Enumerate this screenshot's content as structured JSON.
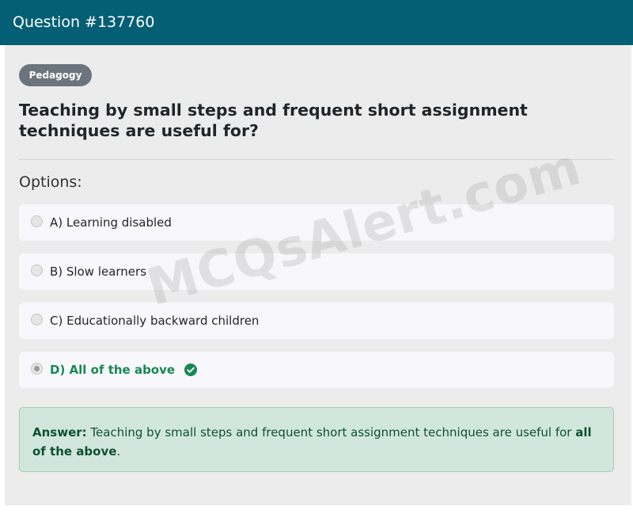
{
  "header": {
    "title": "Question #137760"
  },
  "tag": {
    "label": "Pedagogy"
  },
  "question": {
    "text": "Teaching by small steps and frequent short assignment techniques are useful for?"
  },
  "options_label": "Options:",
  "options": [
    {
      "label": "A) Learning disabled",
      "selected": false,
      "correct": false
    },
    {
      "label": "B) Slow learners",
      "selected": false,
      "correct": false
    },
    {
      "label": "C) Educationally backward children",
      "selected": false,
      "correct": false
    },
    {
      "label": "D) All of the above",
      "selected": true,
      "correct": true
    }
  ],
  "answer": {
    "prefix": "Answer:",
    "body": " Teaching by small steps and frequent short assignment techniques are useful for ",
    "emphasis": "all of the above",
    "suffix": "."
  },
  "watermark": "MCQsAlert.com",
  "colors": {
    "header_bg": "#045f74",
    "tag_bg": "#6c757d",
    "correct": "#198754",
    "answer_bg": "#d1e7dd"
  },
  "icons": {
    "correct": "check-circle-icon"
  }
}
